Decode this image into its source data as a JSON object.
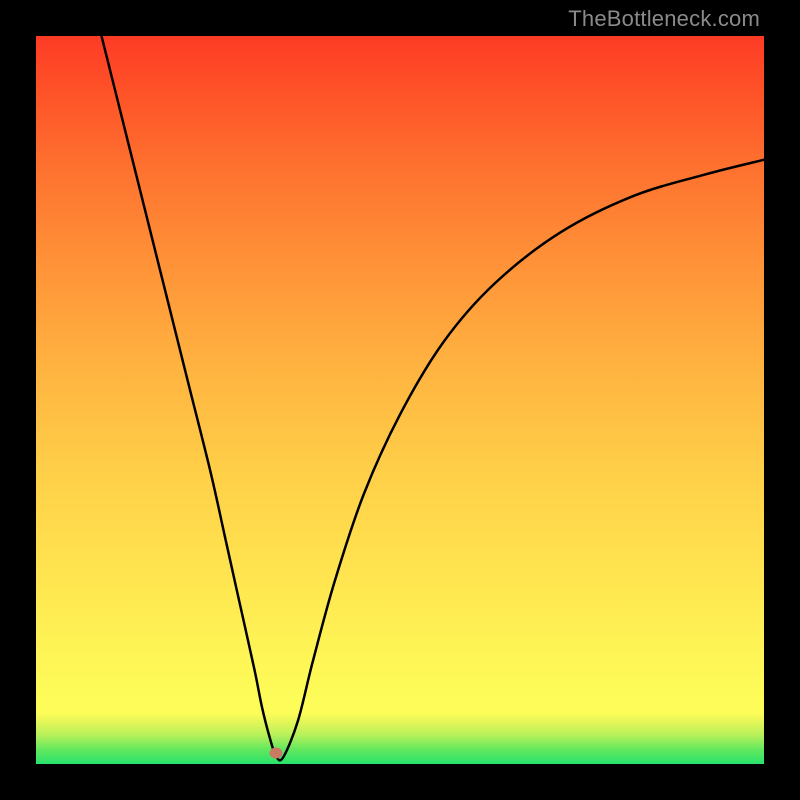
{
  "watermark": "TheBottleneck.com",
  "chart_data": {
    "type": "line",
    "title": "",
    "xlabel": "",
    "ylabel": "",
    "xlim": [
      0,
      100
    ],
    "ylim": [
      0,
      100
    ],
    "series": [
      {
        "name": "curve",
        "x": [
          9,
          12,
          15,
          18,
          21,
          24,
          26,
          28,
          30,
          31,
          32,
          33,
          34,
          36,
          38,
          41,
          45,
          50,
          56,
          63,
          72,
          82,
          92,
          100
        ],
        "y": [
          100,
          88,
          76,
          64,
          52,
          40,
          31,
          22,
          13,
          8,
          4,
          1,
          1,
          6,
          14,
          25,
          37,
          48,
          58,
          66,
          73,
          78,
          81,
          83
        ]
      }
    ],
    "marker": {
      "x": 33,
      "y": 1.5
    },
    "background_gradient": {
      "type": "vertical",
      "stops": [
        {
          "pos": 0,
          "color": "#28e26b"
        },
        {
          "pos": 7,
          "color": "#fdfd58"
        },
        {
          "pos": 55,
          "color": "#ffb240"
        },
        {
          "pos": 100,
          "color": "#fd3b25"
        }
      ]
    }
  }
}
